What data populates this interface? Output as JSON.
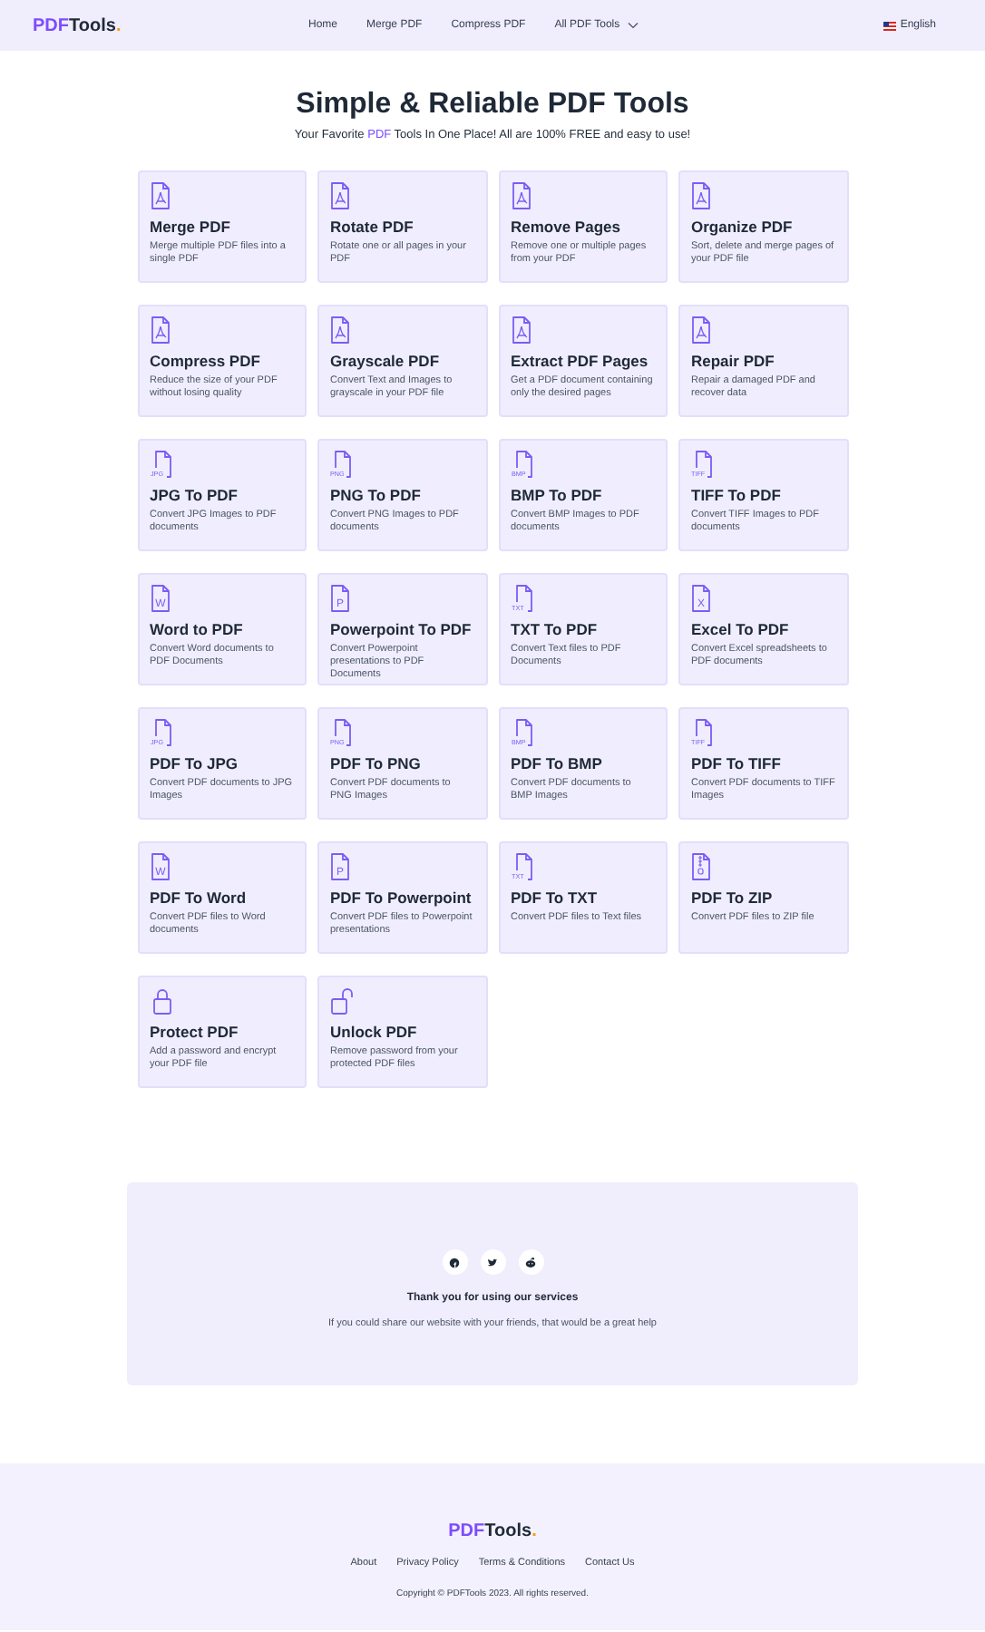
{
  "header": {
    "logo": [
      {
        "text": "PDF",
        "color": "#7c4dff"
      },
      {
        "text": "Tools",
        "color": "#1f2937"
      },
      {
        "text": ".",
        "color": "#f59e0b"
      }
    ],
    "nav": [
      {
        "label": "Home",
        "dropdown": false
      },
      {
        "label": "Merge PDF",
        "dropdown": false
      },
      {
        "label": "Compress PDF",
        "dropdown": false
      },
      {
        "label": "All PDF Tools",
        "dropdown": true
      }
    ],
    "language": "English"
  },
  "hero": {
    "title": "Simple & Reliable PDF Tools",
    "subtitle": [
      {
        "text": "Your Favorite ",
        "accent": false
      },
      {
        "text": "PDF",
        "accent": true
      },
      {
        "text": " Tools In One Place! All are 100% FREE and easy to use!",
        "accent": false
      }
    ]
  },
  "tools": [
    {
      "icon": {
        "kind": "pdf"
      },
      "title": "Merge PDF",
      "description": "Merge multiple PDF files into a single PDF"
    },
    {
      "icon": {
        "kind": "pdf"
      },
      "title": "Rotate PDF",
      "description": "Rotate one or all pages in your PDF"
    },
    {
      "icon": {
        "kind": "pdf"
      },
      "title": "Remove Pages",
      "description": "Remove one or multiple pages from your PDF"
    },
    {
      "icon": {
        "kind": "pdf"
      },
      "title": "Organize PDF",
      "description": "Sort, delete and merge pages of your PDF file"
    },
    {
      "icon": {
        "kind": "pdf"
      },
      "title": "Compress PDF",
      "description": "Reduce the size of your PDF without losing quality"
    },
    {
      "icon": {
        "kind": "pdf"
      },
      "title": "Grayscale PDF",
      "description": "Convert Text and Images to grayscale in your PDF file"
    },
    {
      "icon": {
        "kind": "pdf"
      },
      "title": "Extract PDF Pages",
      "description": "Get a PDF document containing only the desired pages"
    },
    {
      "icon": {
        "kind": "pdf"
      },
      "title": "Repair PDF",
      "description": "Repair a damaged PDF and recover data"
    },
    {
      "icon": {
        "kind": "tag",
        "text": "JPG"
      },
      "title": "JPG To PDF",
      "description": "Convert JPG Images to PDF documents"
    },
    {
      "icon": {
        "kind": "tag",
        "text": "PNG"
      },
      "title": "PNG To PDF",
      "description": "Convert PNG Images to PDF documents"
    },
    {
      "icon": {
        "kind": "tag",
        "text": "BMP"
      },
      "title": "BMP To PDF",
      "description": "Convert BMP Images to PDF documents"
    },
    {
      "icon": {
        "kind": "tag",
        "text": "TIFF"
      },
      "title": "TIFF To PDF",
      "description": "Convert TIFF Images to PDF documents"
    },
    {
      "icon": {
        "kind": "letter",
        "text": "W"
      },
      "title": "Word to PDF",
      "description": "Convert Word documents to PDF Documents"
    },
    {
      "icon": {
        "kind": "letter",
        "text": "P"
      },
      "title": "Powerpoint To PDF",
      "description": "Convert Powerpoint presentations to PDF Documents"
    },
    {
      "icon": {
        "kind": "tag",
        "text": "TXT"
      },
      "title": "TXT To PDF",
      "description": "Convert Text files to PDF Documents"
    },
    {
      "icon": {
        "kind": "letter",
        "text": "X"
      },
      "title": "Excel To PDF",
      "description": "Convert Excel spreadsheets to PDF documents"
    },
    {
      "icon": {
        "kind": "tag",
        "text": "JPG"
      },
      "title": "PDF To JPG",
      "description": "Convert PDF documents to JPG Images"
    },
    {
      "icon": {
        "kind": "tag",
        "text": "PNG"
      },
      "title": "PDF To PNG",
      "description": "Convert PDF documents to PNG Images"
    },
    {
      "icon": {
        "kind": "tag",
        "text": "BMP"
      },
      "title": "PDF To BMP",
      "description": "Convert PDF documents to BMP Images"
    },
    {
      "icon": {
        "kind": "tag",
        "text": "TIFF"
      },
      "title": "PDF To TIFF",
      "description": "Convert PDF documents to TIFF Images"
    },
    {
      "icon": {
        "kind": "letter",
        "text": "W"
      },
      "title": "PDF To Word",
      "description": "Convert PDF files to Word documents"
    },
    {
      "icon": {
        "kind": "letter",
        "text": "P"
      },
      "title": "PDF To Powerpoint",
      "description": "Convert PDF files to Powerpoint presentations"
    },
    {
      "icon": {
        "kind": "tag",
        "text": "TXT"
      },
      "title": "PDF To TXT",
      "description": "Convert PDF files to Text files"
    },
    {
      "icon": {
        "kind": "zip"
      },
      "title": "PDF To ZIP",
      "description": "Convert PDF files to ZIP file"
    },
    {
      "icon": {
        "kind": "lock"
      },
      "title": "Protect PDF",
      "description": "Add a password and encrypt your PDF file"
    },
    {
      "icon": {
        "kind": "unlock"
      },
      "title": "Unlock PDF",
      "description": "Remove password from your protected PDF files"
    }
  ],
  "share": {
    "icons": [
      {
        "kind": "facebook"
      },
      {
        "kind": "twitter"
      },
      {
        "kind": "reddit"
      }
    ],
    "title": "Thank you for using our services",
    "text": "If you could share our website with your friends, that would be a great help"
  },
  "footer": {
    "logo": [
      {
        "text": "PDF",
        "color": "#7c4dff"
      },
      {
        "text": "Tools",
        "color": "#1f2937"
      },
      {
        "text": ".",
        "color": "#f59e0b"
      }
    ],
    "links": [
      "About",
      "Privacy Policy",
      "Terms & Conditions",
      "Contact Us"
    ],
    "copyright": "Copyright © PDFTools 2023. All rights reserved."
  }
}
